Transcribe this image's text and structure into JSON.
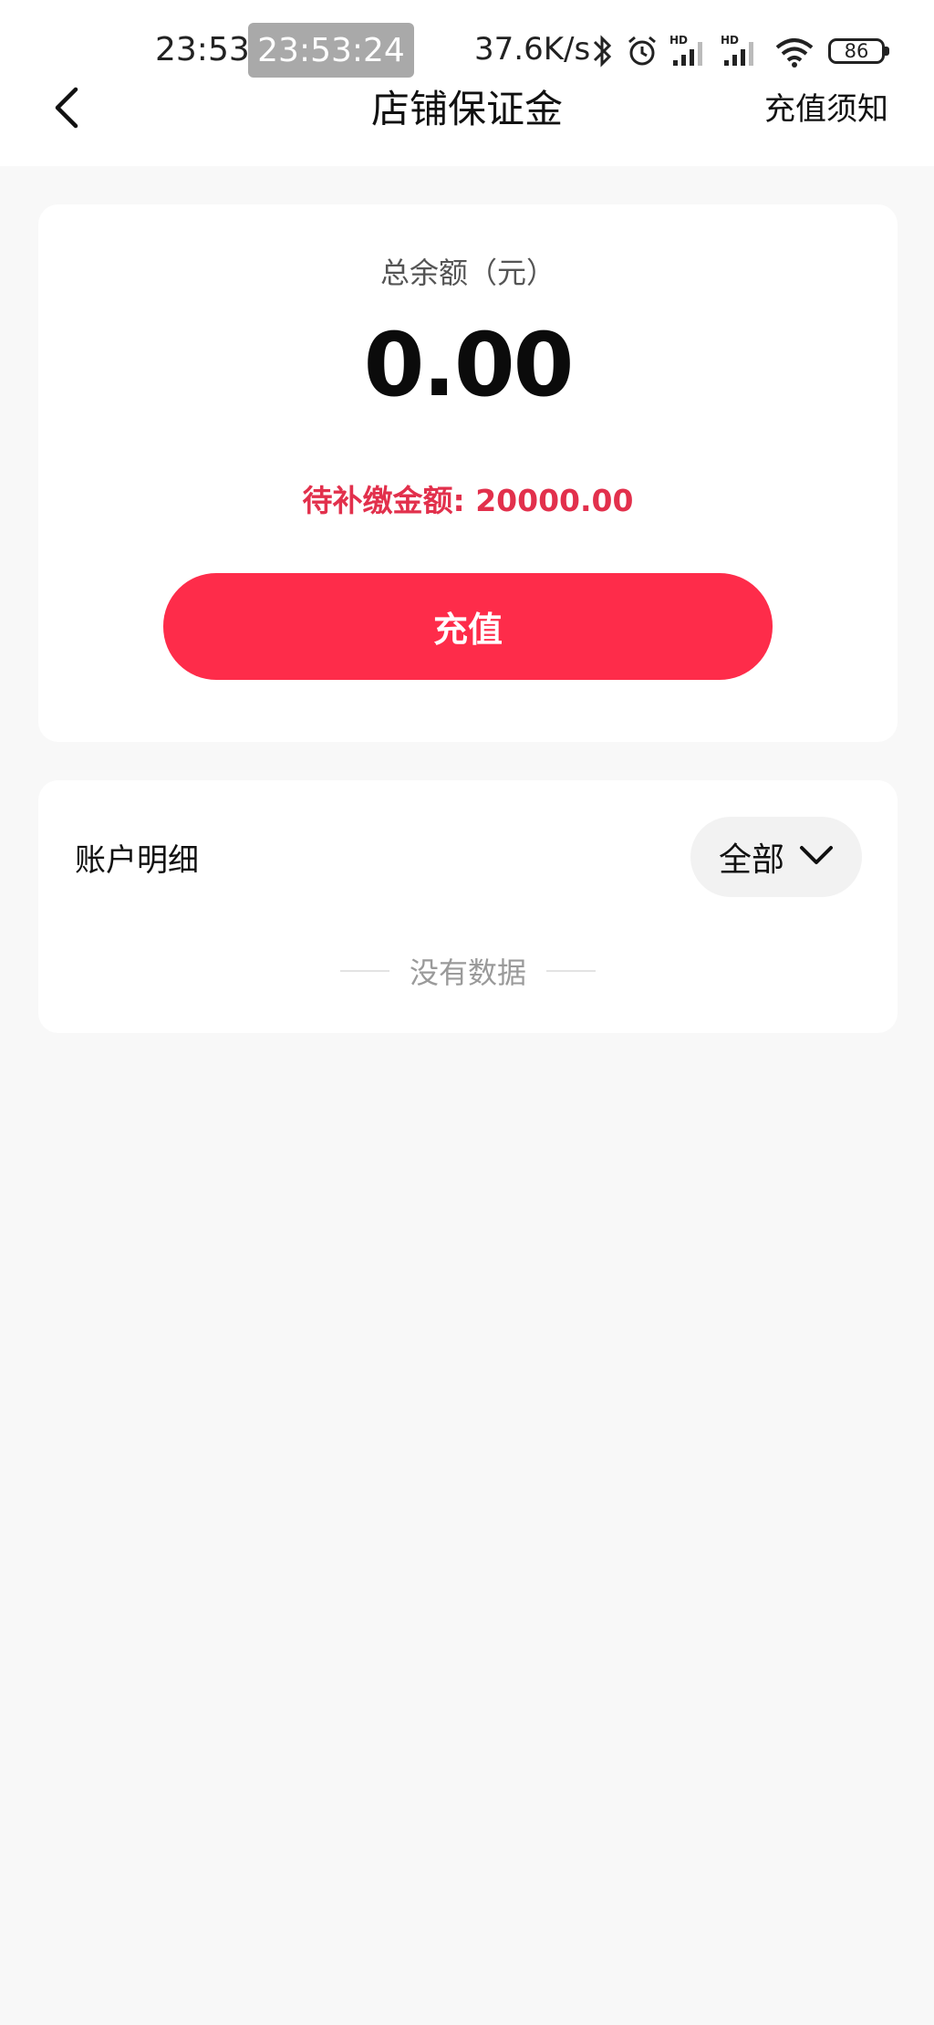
{
  "status_bar": {
    "time": "23:53",
    "clock_overlay": "23:53:24",
    "network_speed": "37.6K/s",
    "battery": "86",
    "icons": [
      "bluetooth-icon",
      "alarm-icon",
      "signal-hd-icon",
      "signal-hd-icon",
      "wifi-icon",
      "battery-icon"
    ]
  },
  "nav": {
    "title": "店铺保证金",
    "right_link": "充值须知",
    "back_icon": "chevron-left-icon"
  },
  "balance": {
    "label": "总余额（元）",
    "amount": "0.00",
    "due_label": "待补缴金额: ",
    "due_amount": "20000.00",
    "recharge_button": "充值",
    "accent_color": "#fe2c4a"
  },
  "details": {
    "title": "账户明细",
    "filter_label": "全部",
    "filter_icon": "chevron-down-icon",
    "empty_text": "没有数据"
  }
}
